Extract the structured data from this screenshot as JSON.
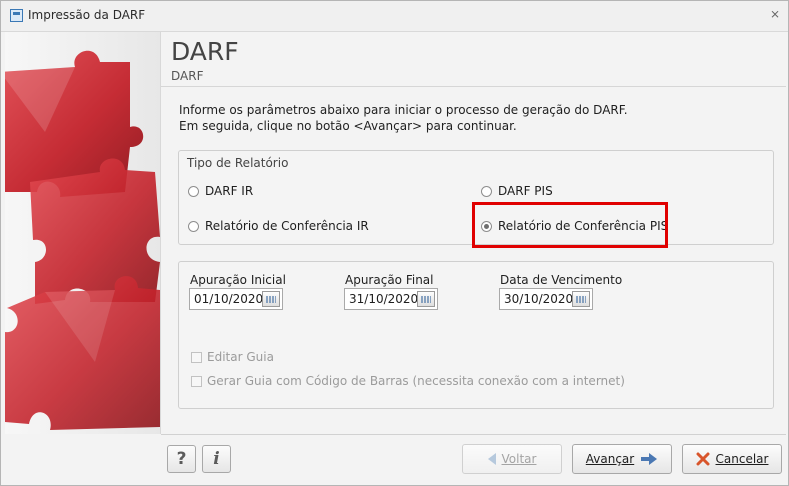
{
  "window": {
    "title": "Impressão da DARF",
    "close_glyph": "⨯"
  },
  "header": {
    "title": "DARF",
    "subtitle": "DARF"
  },
  "intro": {
    "line1": "Informe os parâmetros abaixo para iniciar o processo de geração do DARF.",
    "line2": "Em seguida, clique no botão <Avançar> para continuar."
  },
  "report_type": {
    "label": "Tipo de Relatório",
    "options": [
      {
        "label": "DARF IR",
        "checked": false
      },
      {
        "label": "DARF PIS",
        "checked": false
      },
      {
        "label": "Relatório de Conferência IR",
        "checked": false
      },
      {
        "label": "Relatório de Conferência PIS",
        "checked": true
      }
    ]
  },
  "dates": {
    "initial": {
      "label": "Apuração Inicial",
      "value": "01/10/2020"
    },
    "final": {
      "label": "Apuração Final",
      "value": "31/10/2020"
    },
    "due": {
      "label": "Data de Vencimento",
      "value": "30/10/2020"
    }
  },
  "options": {
    "edit_guide": {
      "label": "Editar Guia",
      "checked": false,
      "enabled": false
    },
    "barcode": {
      "label": "Gerar Guia com Código de Barras (necessita conexão com a internet)",
      "checked": false,
      "enabled": false
    }
  },
  "footer": {
    "help": "?",
    "info": "i",
    "back": "Voltar",
    "next": "Avançar",
    "cancel": "Cancelar"
  },
  "colors": {
    "highlight": "#e00000",
    "puzzle": "#c3222b",
    "cancel_icon": "#d8552b",
    "next_arrow": "#4b78b3"
  },
  "icons": [
    "app-icon",
    "close-icon",
    "calendar-icon",
    "help-icon",
    "info-icon",
    "arrow-left-icon",
    "arrow-right-icon",
    "cancel-x-icon",
    "puzzle-image"
  ]
}
